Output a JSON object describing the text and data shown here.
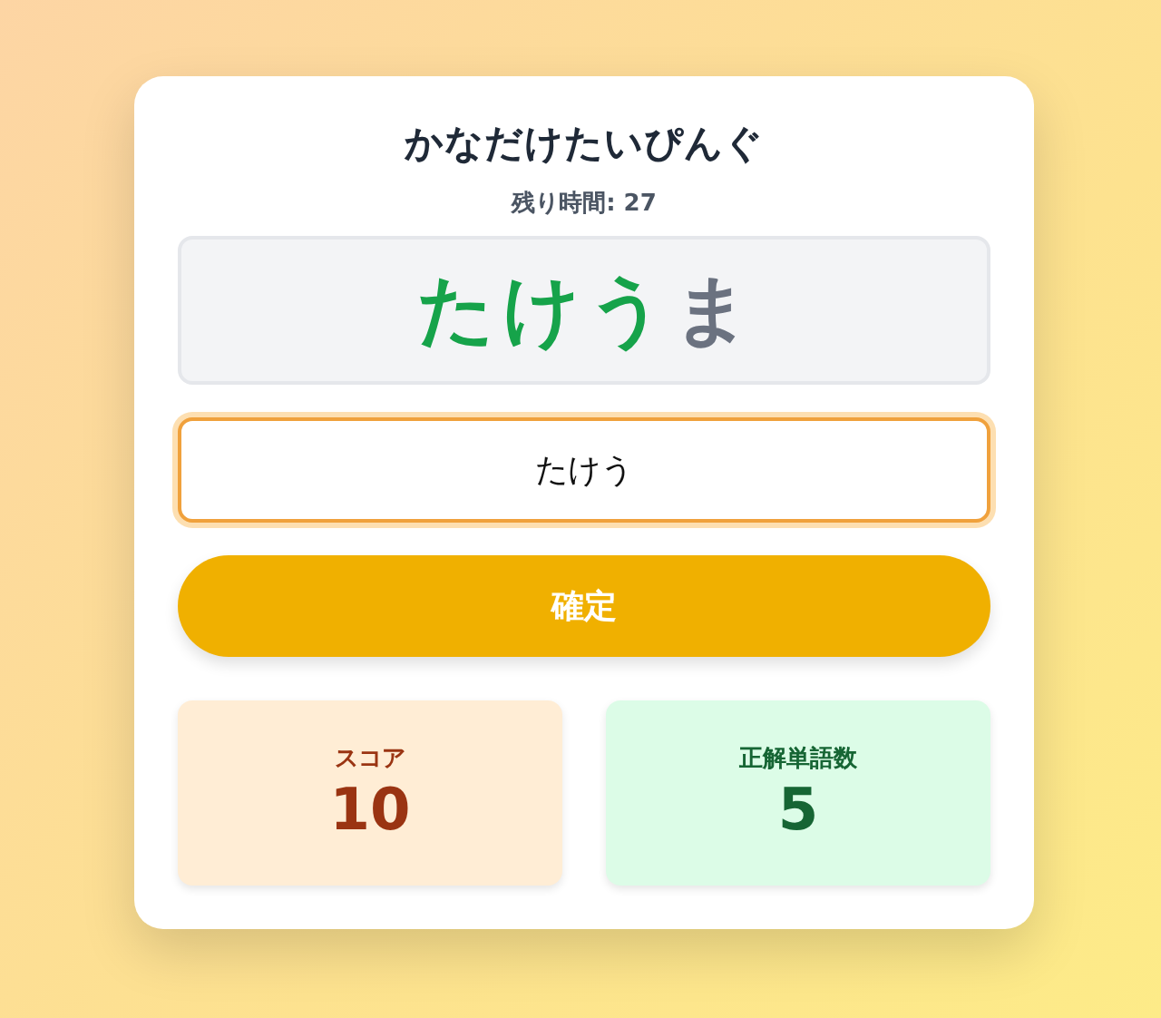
{
  "title": "かなだけたいぴんぐ",
  "timer": "残り時間: 27",
  "word": [
    {
      "char": "た",
      "typed": true
    },
    {
      "char": "け",
      "typed": true
    },
    {
      "char": "う",
      "typed": true
    },
    {
      "char": "ま",
      "typed": false
    }
  ],
  "input": {
    "value": "たけう"
  },
  "submit_button": "確定",
  "stats": [
    {
      "kind": "score",
      "label": "スコア",
      "value": "10"
    },
    {
      "kind": "correct",
      "label": "正解単語数",
      "value": "5"
    }
  ]
}
